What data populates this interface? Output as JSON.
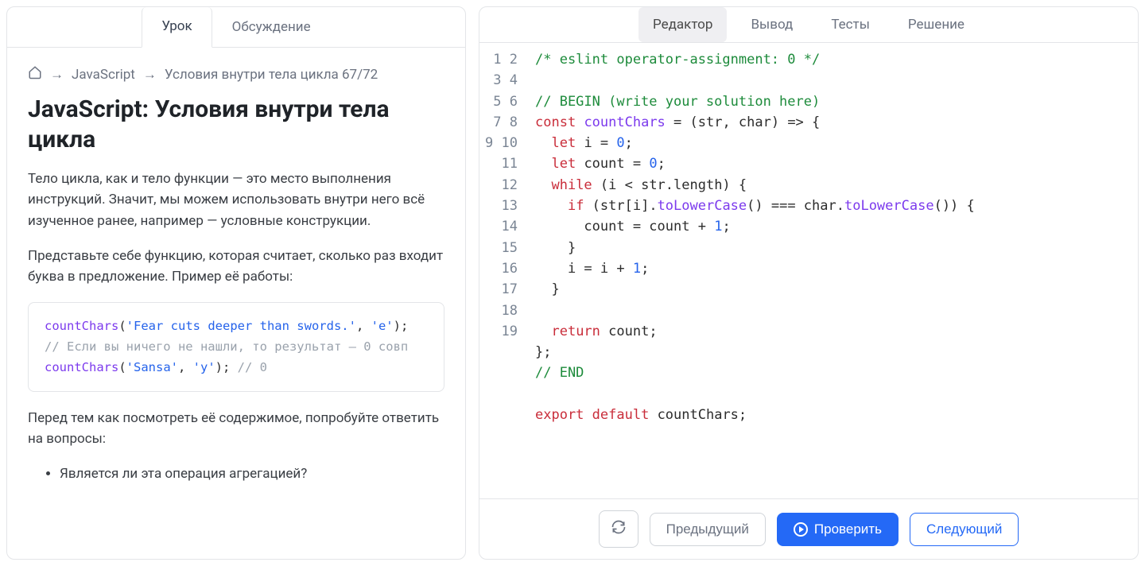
{
  "leftTabs": {
    "lesson": "Урок",
    "discussion": "Обсуждение"
  },
  "breadcrumb": {
    "course": "JavaScript",
    "lesson": "Условия внутри тела цикла 67/72"
  },
  "title": "JavaScript: Условия внутри тела цикла",
  "para1": "Тело цикла, как и тело функции — это место выполнения инструкций. Значит, мы можем использовать внутри него всё изученное ранее, например — условные конструкции.",
  "para2": "Представьте себе функцию, которая считает, сколько раз входит буква в предложение. Пример её работы:",
  "sample": {
    "fn1": "countChars",
    "s1": "'Fear cuts deeper than swords.'",
    "s2": "'e'",
    "com1": "// Если вы ничего не нашли, то результат — 0 совп",
    "fn2": "countChars",
    "s3": "'Sansa'",
    "s4": "'y'",
    "com2": "// 0"
  },
  "para3": "Перед тем как посмотреть её содержимое, попробуйте ответить на вопросы:",
  "bullet1": "Является ли эта операция агрегацией?",
  "rightTabs": {
    "editor": "Редактор",
    "output": "Вывод",
    "tests": "Тесты",
    "solution": "Решение"
  },
  "code": {
    "l1_com": "/* eslint operator-assignment: 0 */",
    "l3_com": "// BEGIN (write your solution here)",
    "l4_const": "const",
    "l4_name": "countChars",
    "l4_rest": " = (str, char) => {",
    "l5_let": "let",
    "l5_rest": " i = ",
    "l5_num": "0",
    "l6_let": "let",
    "l6_rest": " count = ",
    "l6_num": "0",
    "l7_while": "while",
    "l7_rest": " (i < str.length) {",
    "l8_if": "if",
    "l8_a": " (str[i].",
    "l8_fn1": "toLowerCase",
    "l8_b": "() === char.",
    "l8_fn2": "toLowerCase",
    "l8_c": "()) {",
    "l9_rest": "count = count + ",
    "l9_num": "1",
    "l10": "}",
    "l11_rest": "i = i + ",
    "l11_num": "1",
    "l12": "}",
    "l14_return": "return",
    "l14_rest": " count;",
    "l15": "};",
    "l16_com": "// END",
    "l18_export": "export",
    "l18_default": "default",
    "l18_rest": " countChars;"
  },
  "footer": {
    "prev": "Предыдущий",
    "check": "Проверить",
    "next": "Следующий"
  }
}
